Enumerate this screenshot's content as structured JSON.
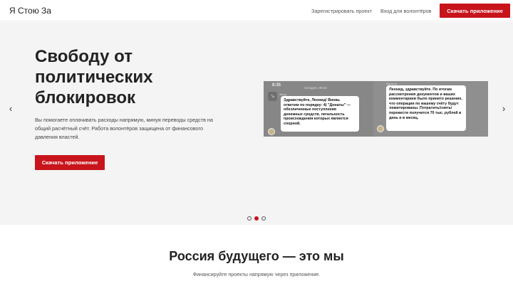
{
  "header": {
    "logo": "Я Стою За",
    "nav_register": "Зарегистрировать проект",
    "nav_volunteer": "Вход для волонтёров",
    "cta": "Скачать приложение"
  },
  "hero": {
    "title": "Свободу от политических блокировок",
    "description": "Вы помогаете оплачивать расходы напрямую, минуя переводы средств на общий расчётный счёт. Работа волонтёров защищена от финансового давления властей.",
    "cta": "Скачать приложение",
    "screenshot": {
      "left": {
        "time": "8:35",
        "date": "Сегодня, 08:33",
        "label": "Фонд",
        "message": "Здравствуйте, Леонид! Вновь ответим по порядку: 4) \"Донаты\" — обезличенные поступления денежных средств, легальность происхождения которых является спорной."
      },
      "right": {
        "label": "Куратор",
        "message": "Леонид, здравствуйте. По итогам рассмотрения документов и ваших комментариев было принято решение, что операции по вашему счёту будут лимитированы. Потратить/снять/перевести получится 70 тыс. рублей в день и в месяц."
      }
    },
    "carousel": {
      "active": 2,
      "total": 3
    }
  },
  "section": {
    "title": "Россия будущего — это мы",
    "subtitle": "Финансируйте проекты напрямую через приложение."
  },
  "colors": {
    "accent": "#c8141b",
    "hero_bg": "#f4f4f4"
  },
  "icons": {
    "prev": "chevron-left-icon",
    "next": "chevron-right-icon"
  }
}
